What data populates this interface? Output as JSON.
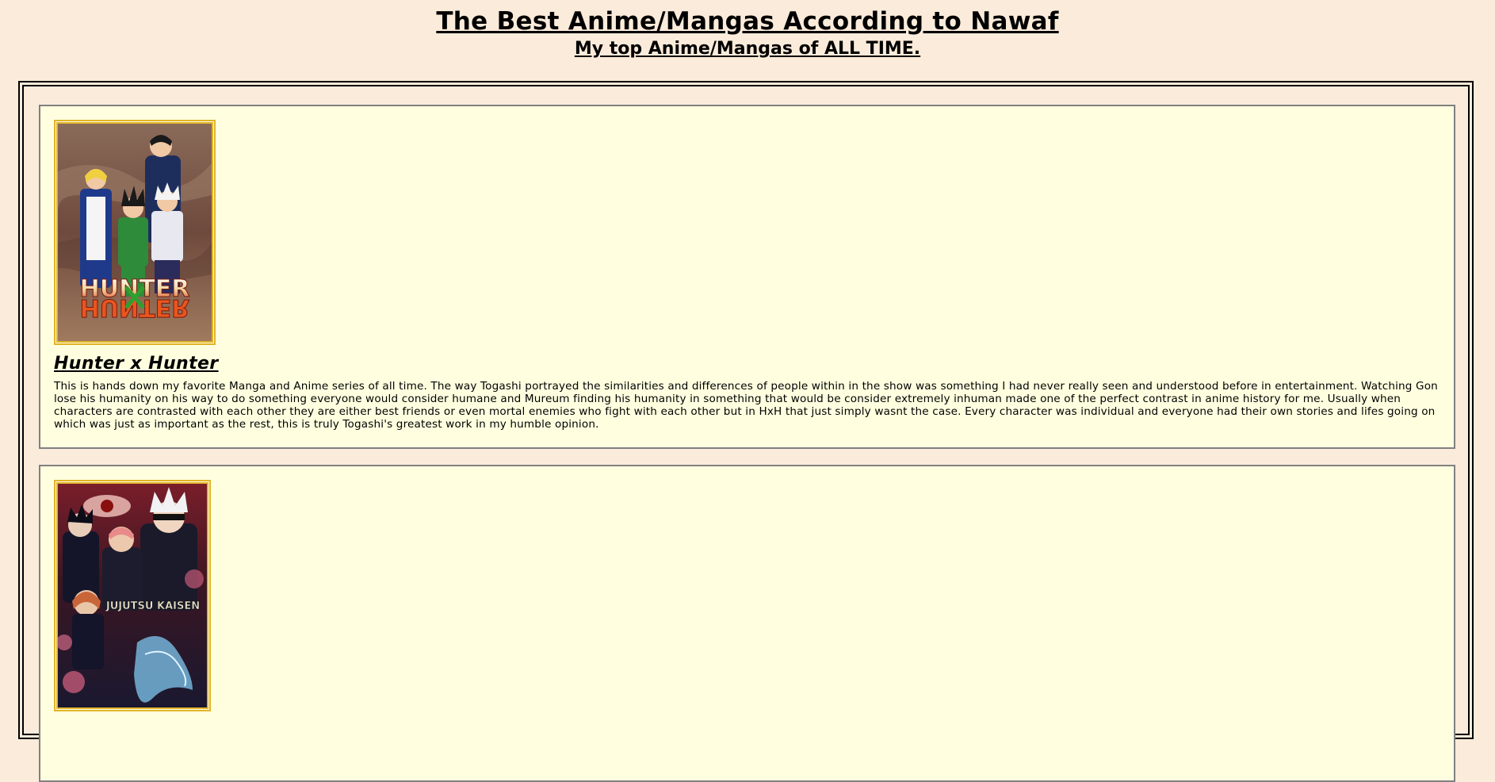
{
  "header": {
    "title": "The Best Anime/Mangas According to Nawaf",
    "subtitle": "My top Anime/Mangas of ALL TIME."
  },
  "entries": [
    {
      "title": "Hunter x Hunter",
      "poster_text": "HUNTER",
      "description": "This is hands down my favorite Manga and Anime series of all time. The way Togashi portrayed the similarities and differences of people within in the show was something I had never really seen and understood before in entertainment. Watching Gon lose his humanity on his way to do something everyone would consider humane and Mureum finding his humanity in something that would be consider extremely inhuman made one of the perfect contrast in anime history for me. Usually when characters are contrasted with each other they are either best friends or even mortal enemies who fight with each other but in HxH that just simply wasnt the case. Every character was individual and everyone had their own stories and lifes going on which was just as important as the rest, this is truly Togashi's greatest work in my humble opinion."
    },
    {
      "poster_text": "JUJUTSU KAISEN"
    }
  ],
  "colors": {
    "page_background": "#fbebda",
    "card_background": "#ffffe0",
    "poster_border": "#e2b42a"
  }
}
